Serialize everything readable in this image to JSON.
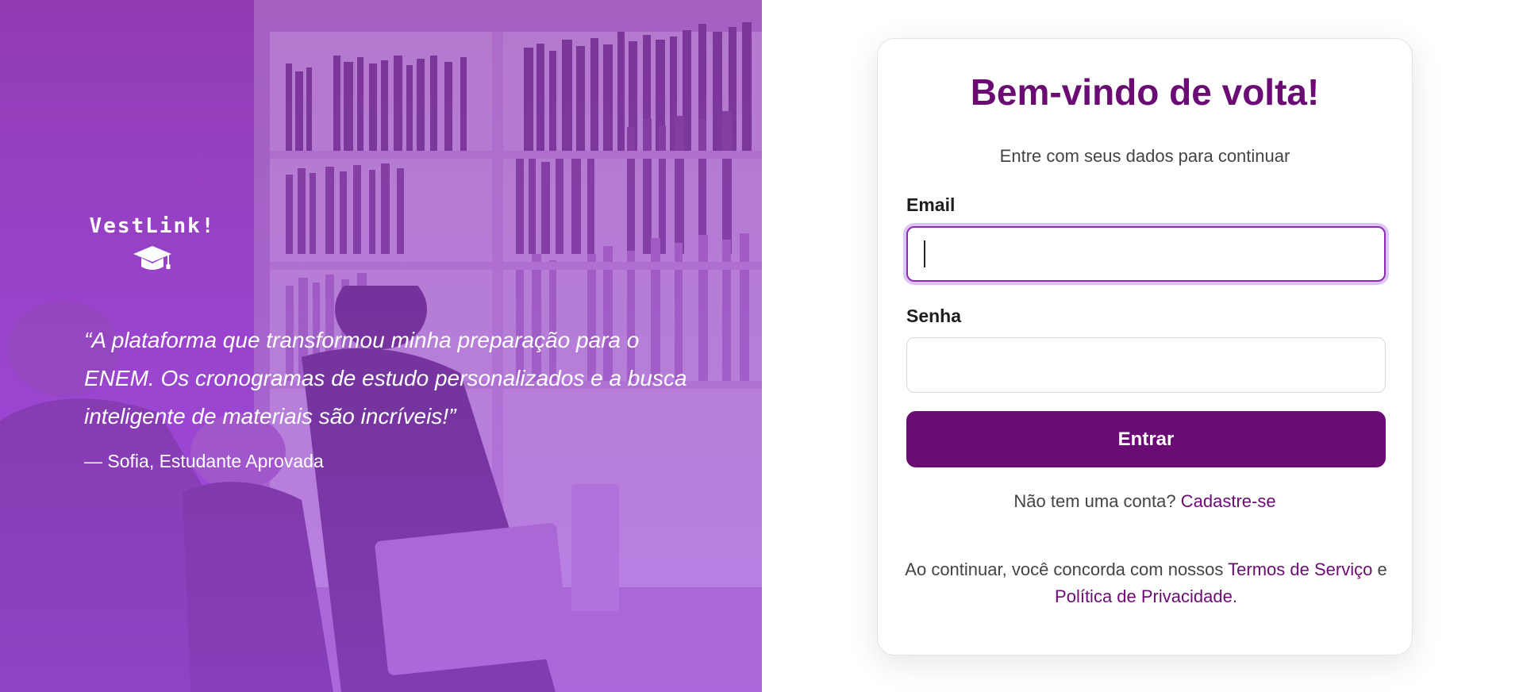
{
  "hero": {
    "brand_name": "VestLink!",
    "brand_icon": "graduation-cap-icon",
    "quote": "“A plataforma que transformou minha preparação para o ENEM. Os cronogramas de estudo personalizados e a busca inteligente de materiais são incríveis!”",
    "quote_author": "— Sofia, Estudante Aprovada",
    "overlay_color": "#9a45c8"
  },
  "login": {
    "title": "Bem-vindo de volta!",
    "subtitle": "Entre com seus dados para continuar",
    "email_label": "Email",
    "email_value": "",
    "password_label": "Senha",
    "password_value": "",
    "submit_label": "Entrar",
    "signup_prompt": "Não tem uma conta?",
    "signup_link": "Cadastre-se",
    "terms_prefix": "Ao continuar, você concorda com nossos",
    "terms_link": "Termos de Serviço",
    "terms_and": "e",
    "privacy_link": "Política de Privacidade",
    "terms_suffix": "."
  },
  "colors": {
    "accent": "#6b0b74",
    "focus_ring": "#dcc6f6"
  }
}
